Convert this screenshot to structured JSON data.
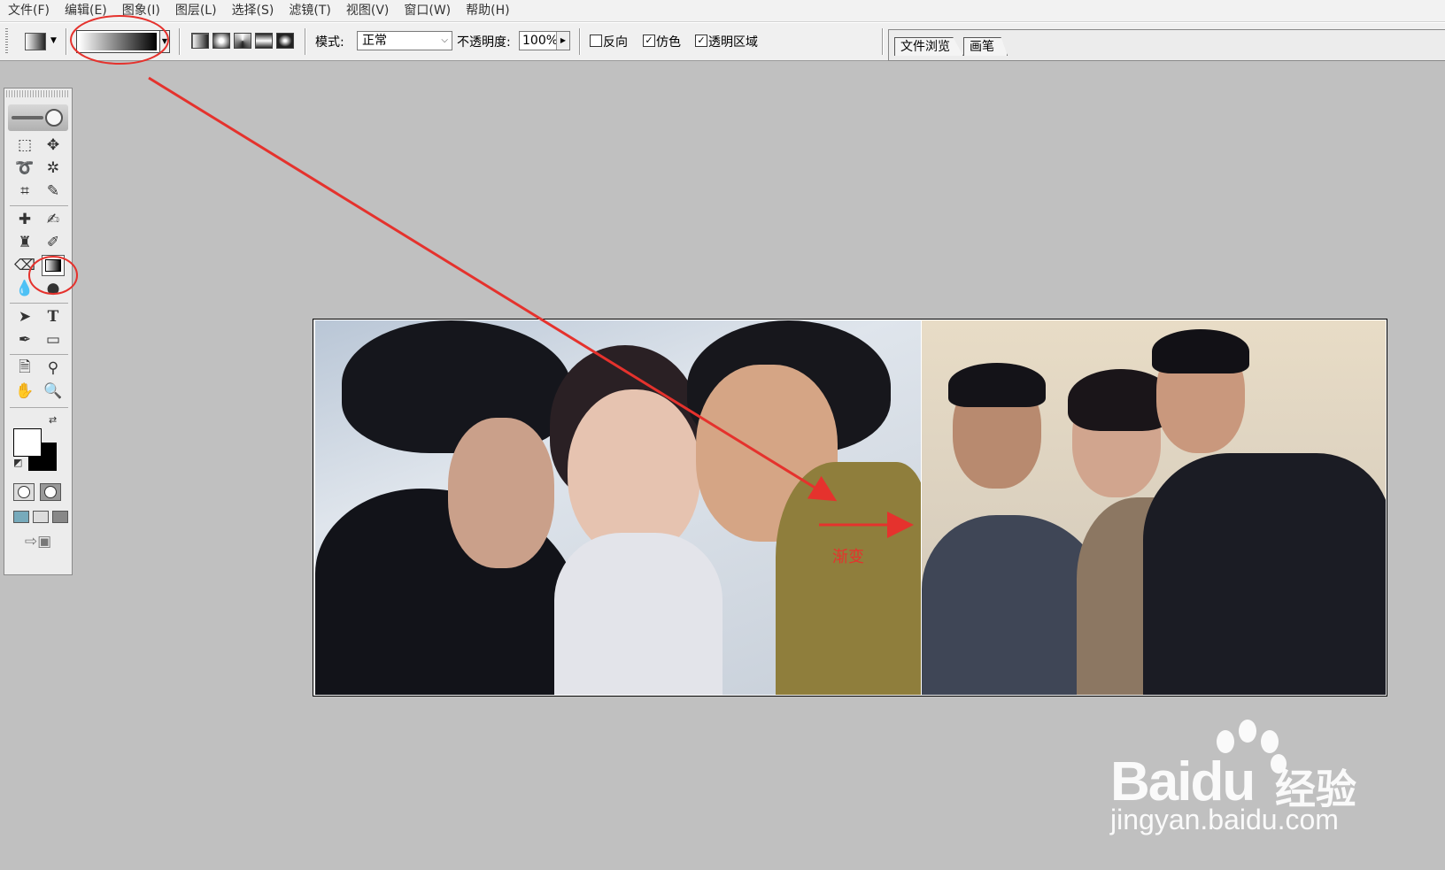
{
  "menu": [
    "文件(F)",
    "编辑(E)",
    "图象(I)",
    "图层(L)",
    "选择(S)",
    "滤镜(T)",
    "视图(V)",
    "窗口(W)",
    "帮助(H)"
  ],
  "options": {
    "mode_label": "模式:",
    "mode_value": "正常",
    "opacity_label": "不透明度:",
    "opacity_value": "100%",
    "reverse_label": "反向",
    "dither_label": "仿色",
    "transparency_label": "透明区域",
    "reverse_checked": false,
    "dither_checked": true,
    "transparency_checked": true,
    "gradient_start": "#ffffff",
    "gradient_end": "#000000"
  },
  "palette_well": {
    "tabs": [
      "文件浏览",
      "画笔"
    ]
  },
  "colors": {
    "foreground": "#ffffff",
    "background": "#000000",
    "annotation": "#e5322d"
  },
  "annotation": {
    "label": "渐变"
  },
  "watermark": {
    "brand": "Bai",
    "brand_suffix": "du",
    "cn": "经验",
    "url": "jingyan.baidu.com"
  }
}
